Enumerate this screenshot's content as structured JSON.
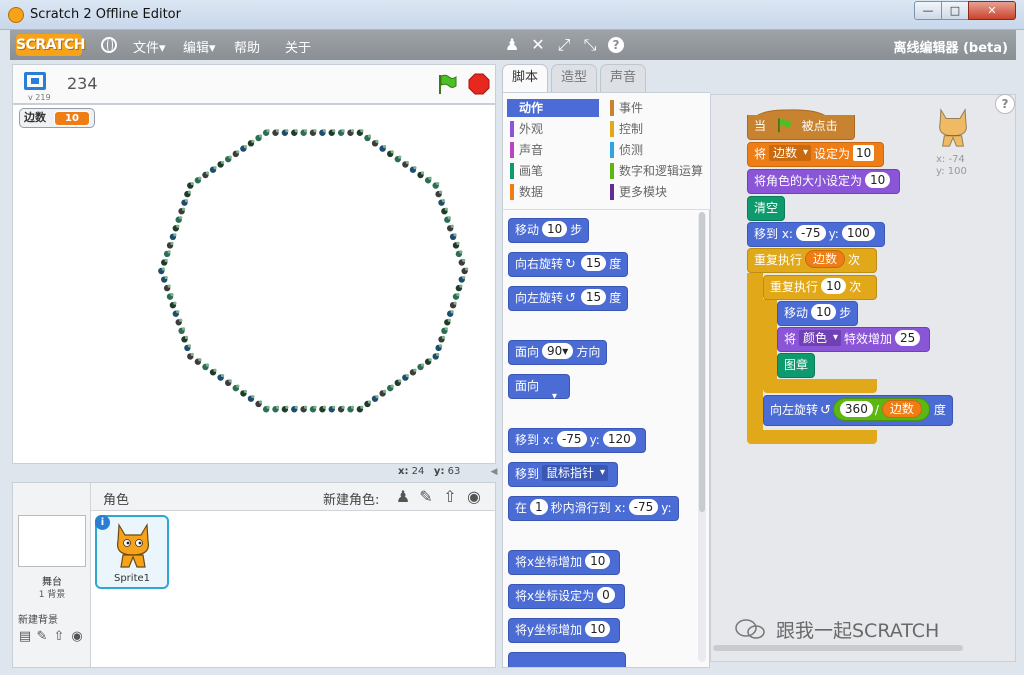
{
  "window": {
    "title": "Scratch 2 Offline Editor",
    "min": "—",
    "max": "□",
    "close": "✕"
  },
  "menubar": {
    "logo": "SCRATCH",
    "file": "文件▾",
    "edit": "编辑▾",
    "help": "帮助",
    "about": "关于",
    "offline_label": "离线编辑器 (beta)"
  },
  "stage": {
    "version": "v 219",
    "project_name": "234",
    "monitor_label": "边数",
    "monitor_value": "10",
    "mouse_x_label": "x:",
    "mouse_x": "24",
    "mouse_y_label": "y:",
    "mouse_y": "63"
  },
  "sprites": {
    "header": "角色",
    "new_sprite": "新建角色:",
    "stage_label": "舞台",
    "backdrop_count": "1 背景",
    "new_backdrop": "新建背景",
    "sprite_name": "Sprite1",
    "info": "i"
  },
  "tabs": {
    "scripts": "脚本",
    "costumes": "造型",
    "sounds": "声音"
  },
  "categories": {
    "motion": "动作",
    "looks": "外观",
    "sound": "声音",
    "pen": "画笔",
    "data": "数据",
    "events": "事件",
    "control": "控制",
    "sensing": "侦测",
    "operators": "数字和逻辑运算",
    "more": "更多模块"
  },
  "palette": {
    "move_a": "移动",
    "move_n": "10",
    "move_b": "步",
    "turn_right_a": "向右旋转",
    "turn_right_n": "15",
    "turn_right_b": "度",
    "turn_left_a": "向左旋转",
    "turn_left_n": "15",
    "turn_left_b": "度",
    "point_dir_a": "面向",
    "point_dir_n": "90▾",
    "point_dir_b": "方向",
    "point_towards": "面向",
    "goto_xy_a": "移到 x:",
    "goto_xy_x": "-75",
    "goto_xy_b": "y:",
    "goto_xy_y": "120",
    "goto_a": "移到",
    "goto_target": "鼠标指针",
    "glide_a": "在",
    "glide_n": "1",
    "glide_b": "秒内滑行到 x:",
    "glide_x": "-75",
    "glide_c": "y:",
    "change_x_a": "将x坐标增加",
    "change_x_n": "10",
    "set_x_a": "将x坐标设定为",
    "set_x_n": "0",
    "change_y_a": "将y坐标增加",
    "change_y_n": "10"
  },
  "script": {
    "hat_a": "当",
    "hat_b": "被点击",
    "set_a": "将",
    "set_var": "边数",
    "set_b": "设定为",
    "set_n": "10",
    "size_a": "将角色的大小设定为",
    "size_n": "10",
    "clear": "清空",
    "goto_a": "移到 x:",
    "goto_x": "-75",
    "goto_b": "y:",
    "goto_y": "100",
    "repeat_a": "重复执行",
    "repeat_var": "边数",
    "repeat_b": "次",
    "repeat2_a": "重复执行",
    "repeat2_n": "10",
    "repeat2_b": "次",
    "move_a": "移动",
    "move_n": "10",
    "move_b": "步",
    "effect_a": "将",
    "effect_sel": "颜色",
    "effect_b": "特效增加",
    "effect_n": "25",
    "stamp": "图章",
    "turn_a": "向左旋转",
    "turn_n": "360",
    "turn_op": "/",
    "turn_var": "边数",
    "turn_b": "度",
    "sprite_x": "x: -74",
    "sprite_y": "y: 100"
  },
  "help_circle": "?",
  "watermark": "跟我一起SCRATCH",
  "colors": {
    "motion": "#4a6cd4",
    "looks": "#8a55d7",
    "sound": "#bb42c3",
    "pen": "#0e9a6c",
    "data": "#ee7d16",
    "events": "#c88330",
    "control": "#e1a91a",
    "sensing": "#2ca5e2",
    "operators": "#5cb712",
    "more": "#632d99"
  }
}
